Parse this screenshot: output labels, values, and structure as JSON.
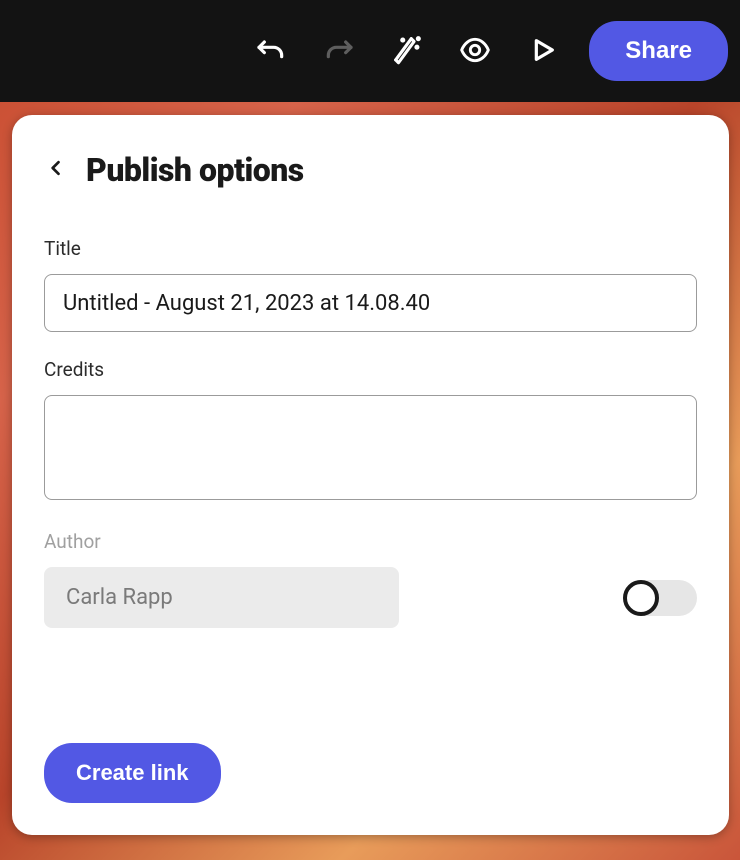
{
  "toolbar": {
    "share_label": "Share"
  },
  "panel": {
    "title": "Publish options",
    "title_field": {
      "label": "Title",
      "value": "Untitled - August 21, 2023 at 14.08.40"
    },
    "credits_field": {
      "label": "Credits",
      "value": ""
    },
    "author_field": {
      "label": "Author",
      "name": "Carla Rapp",
      "toggle_on": false
    },
    "create_link_label": "Create link"
  },
  "colors": {
    "accent": "#5258e4",
    "panel_bg": "#ffffff",
    "topbar_bg": "#131313"
  }
}
